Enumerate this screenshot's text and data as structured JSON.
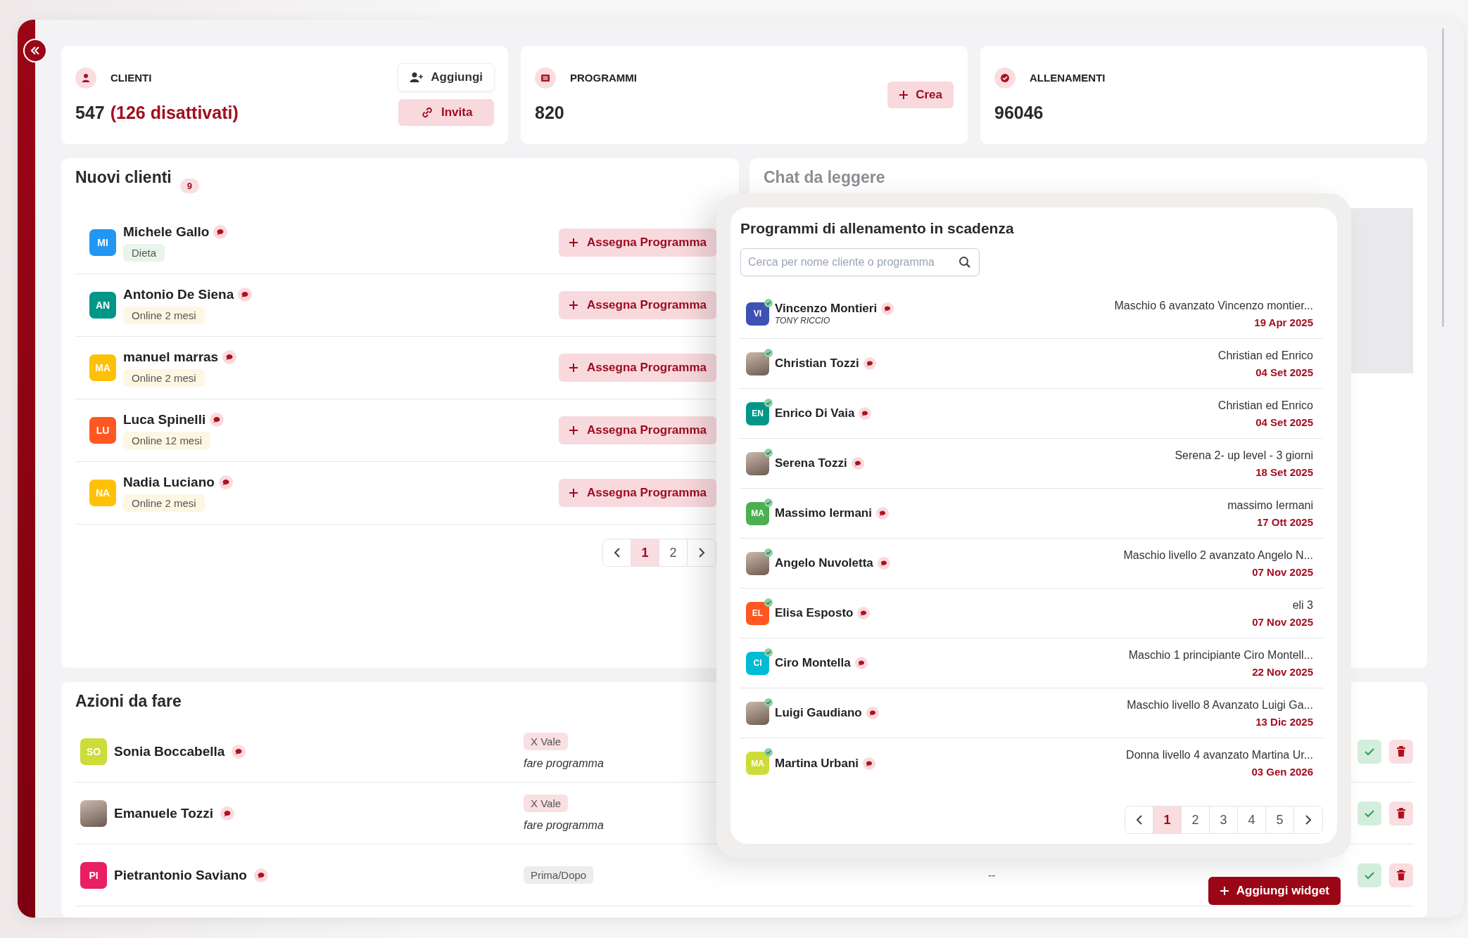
{
  "stats": [
    {
      "kind": "clients",
      "label": "CLIENTI",
      "value": "547",
      "note": "(126 disattivati)",
      "buttons": [
        {
          "kind": "add-user",
          "label": "Aggiungi"
        },
        {
          "kind": "invite",
          "label": "Invita"
        }
      ]
    },
    {
      "kind": "programs",
      "label": "PROGRAMMI",
      "value": "820",
      "buttons": [
        {
          "kind": "create",
          "label": "Crea"
        }
      ]
    },
    {
      "kind": "workouts",
      "label": "ALLENAMENTI",
      "value": "96046"
    }
  ],
  "new_clients": {
    "title": "Nuovi clienti",
    "count": "9",
    "rows": [
      {
        "avatar": {
          "kind": "initials",
          "initials": "MI",
          "color": "#2196f3"
        },
        "name": "Michele Gallo",
        "tag": {
          "label": "Dieta",
          "color": "#e8f5e9"
        },
        "action": "Assegna Programma"
      },
      {
        "avatar": {
          "kind": "initials",
          "initials": "AN",
          "color": "#009688"
        },
        "name": "Antonio De Siena",
        "tag": {
          "label": "Online 2 mesi",
          "color": "#fdf6e3"
        },
        "action": "Assegna Programma"
      },
      {
        "avatar": {
          "kind": "initials",
          "initials": "MA",
          "color": "#ffc107"
        },
        "name": "manuel marras",
        "tag": {
          "label": "Online 2 mesi",
          "color": "#fdf6e3"
        },
        "action": "Assegna Programma"
      },
      {
        "avatar": {
          "kind": "initials",
          "initials": "LU",
          "color": "#ff5722"
        },
        "name": "Luca Spinelli",
        "tag": {
          "label": "Online 12 mesi",
          "color": "#fdf6e3"
        },
        "action": "Assegna Programma"
      },
      {
        "avatar": {
          "kind": "initials",
          "initials": "NA",
          "color": "#ffc107"
        },
        "name": "Nadia Luciano",
        "tag": {
          "label": "Online 2 mesi",
          "color": "#fdf6e3"
        },
        "action": "Assegna Programma"
      }
    ],
    "pages": [
      {
        "label": "1",
        "selected": true
      },
      {
        "label": "2",
        "selected": false
      }
    ]
  },
  "chat": {
    "title": "Chat da leggere"
  },
  "expiring": {
    "title": "Programmi di allenamento in scadenza",
    "search": {
      "placeholder": "Cerca per nome cliente o programma"
    },
    "rows": [
      {
        "avatar": {
          "kind": "initials",
          "initials": "VI",
          "color": "#3f51b5"
        },
        "verified": true,
        "name": "Vincenzo Montieri",
        "coach": "TONY RICCIO",
        "program": "Maschio 6 avanzato Vincenzo montier...",
        "date": "19 Apr 2025"
      },
      {
        "avatar": {
          "kind": "photo"
        },
        "verified": true,
        "name": "Christian Tozzi",
        "program": "Christian ed Enrico",
        "date": "04 Set 2025"
      },
      {
        "avatar": {
          "kind": "initials",
          "initials": "EN",
          "color": "#009688"
        },
        "verified": true,
        "name": "Enrico Di Vaia",
        "program": "Christian ed Enrico",
        "date": "04 Set 2025"
      },
      {
        "avatar": {
          "kind": "photo"
        },
        "verified": true,
        "name": "Serena Tozzi",
        "program": "Serena 2- up level - 3 giorni",
        "date": "18 Set 2025"
      },
      {
        "avatar": {
          "kind": "initials",
          "initials": "MA",
          "color": "#4caf50"
        },
        "verified": true,
        "name": "Massimo Iermani",
        "program": "massimo Iermani",
        "date": "17 Ott 2025"
      },
      {
        "avatar": {
          "kind": "photo"
        },
        "verified": true,
        "name": "Angelo Nuvoletta",
        "program": "Maschio livello 2 avanzato Angelo N...",
        "date": "07 Nov 2025"
      },
      {
        "avatar": {
          "kind": "initials",
          "initials": "EL",
          "color": "#ff5722"
        },
        "verified": true,
        "name": "Elisa Esposto",
        "program": "eli 3",
        "date": "07 Nov 2025"
      },
      {
        "avatar": {
          "kind": "initials",
          "initials": "CI",
          "color": "#00bcd4"
        },
        "verified": true,
        "name": "Ciro Montella",
        "program": "Maschio 1 principiante Ciro Montell...",
        "date": "22 Nov 2025"
      },
      {
        "avatar": {
          "kind": "photo"
        },
        "verified": true,
        "name": "Luigi Gaudiano",
        "program": "Maschio livello 8 Avanzato Luigi Ga...",
        "date": "13 Dic 2025"
      },
      {
        "avatar": {
          "kind": "initials",
          "initials": "MA",
          "color": "#cddc39"
        },
        "verified": true,
        "name": "Martina Urbani",
        "program": "Donna livello 4 avanzato Martina Ur...",
        "date": "03 Gen 2026"
      }
    ],
    "pages": [
      {
        "label": "1",
        "selected": true
      },
      {
        "label": "2",
        "selected": false
      },
      {
        "label": "3",
        "selected": false
      },
      {
        "label": "4",
        "selected": false
      },
      {
        "label": "5",
        "selected": false
      }
    ]
  },
  "actions": {
    "title": "Azioni da fare",
    "rows": [
      {
        "avatar": {
          "kind": "initials",
          "initials": "SO",
          "color": "#cddc39"
        },
        "name": "Sonia Boccabella",
        "tag": {
          "label": "X Vale",
          "color": "#f9dfe2"
        },
        "note": "fare programma"
      },
      {
        "avatar": {
          "kind": "photo"
        },
        "name": "Emanuele Tozzi",
        "tag": {
          "label": "X Vale",
          "color": "#f9dfe2"
        },
        "note": "fare programma"
      },
      {
        "avatar": {
          "kind": "initials",
          "initials": "PI",
          "color": "#e91e63"
        },
        "name": "Pietrantonio Saviano",
        "tag": {
          "label": "Prima/Dopo",
          "color": "#ececec"
        },
        "value": "--"
      }
    ]
  },
  "widget_button": {
    "label": "Aggiungi widget"
  }
}
